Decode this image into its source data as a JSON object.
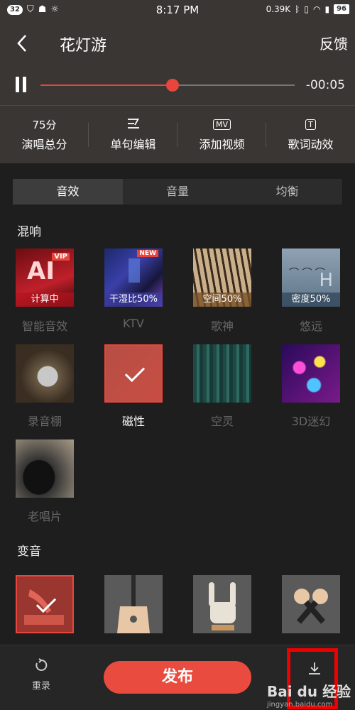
{
  "status_bar": {
    "left_badge": "32",
    "time": "8:17 PM",
    "network_speed": "0.39K",
    "battery": "96"
  },
  "header": {
    "title": "花灯游",
    "feedback": "反馈"
  },
  "player": {
    "remaining_time": "-00:05",
    "progress": 0.52
  },
  "tools": [
    {
      "top": "75分",
      "label": "演唱总分"
    },
    {
      "top": "",
      "label": "单句编辑"
    },
    {
      "top": "MV",
      "label": "添加视频"
    },
    {
      "top": "T",
      "label": "歌词动效"
    }
  ],
  "tabs": [
    "音效",
    "音量",
    "均衡"
  ],
  "active_tab": "音效",
  "sections": {
    "reverb": "混响",
    "voice_change": "变音"
  },
  "reverb_effects": [
    {
      "name": "智能音效",
      "badge": "计算中",
      "thumb_text": "AI",
      "tag": "VIP"
    },
    {
      "name": "KTV",
      "badge": "干湿比50%",
      "tag": "NEW"
    },
    {
      "name": "歌神",
      "badge": "空间50%"
    },
    {
      "name": "悠远",
      "badge": "密度50%"
    },
    {
      "name": "录音棚"
    },
    {
      "name": "磁性",
      "selected": true
    },
    {
      "name": "空灵"
    },
    {
      "name": "3D迷幻"
    },
    {
      "name": "老唱片"
    }
  ],
  "voice_effects": [
    {
      "icon": "gramophone-icon",
      "selected": true
    },
    {
      "icon": "guitar-icon"
    },
    {
      "icon": "rock-hand-icon"
    },
    {
      "icon": "microphones-icon"
    }
  ],
  "bottom": {
    "redo": "重录",
    "publish": "发布"
  },
  "watermark": {
    "line1": "Bai du 经验",
    "line2": "jingyan.baidu.com"
  },
  "colors": {
    "accent": "#e8453c",
    "header_bg": "#3a3634",
    "page_bg": "#1e1e1e"
  }
}
